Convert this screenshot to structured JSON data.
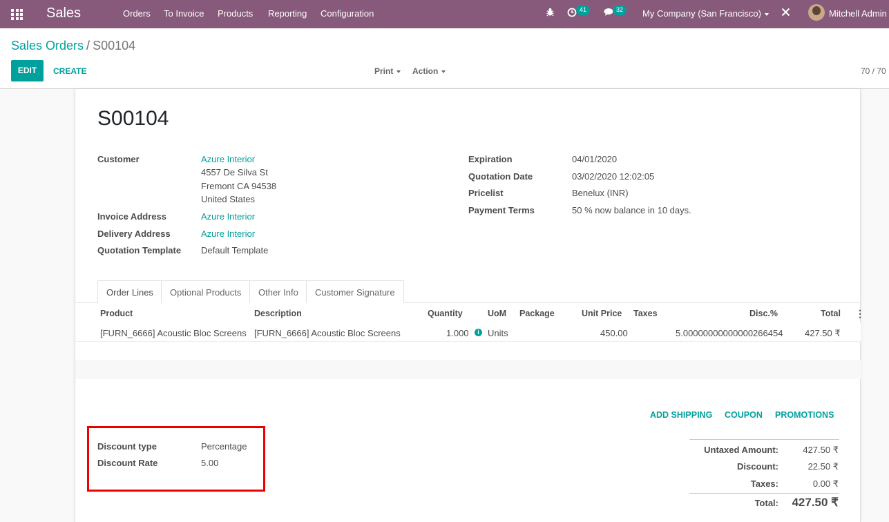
{
  "navbar": {
    "app_name": "Sales",
    "menu": [
      "Orders",
      "To Invoice",
      "Products",
      "Reporting",
      "Configuration"
    ],
    "activity_count": "41",
    "message_count": "32",
    "company": "My Company (San Francisco)",
    "user": "Mitchell Admin",
    "color": "#875a7b"
  },
  "breadcrumb": {
    "parent": "Sales Orders",
    "separator": "/",
    "current": "S00104"
  },
  "toolbar": {
    "edit": "EDIT",
    "create": "CREATE",
    "print": "Print",
    "action": "Action",
    "pager": "70 / 70"
  },
  "order": {
    "name": "S00104",
    "left": {
      "customer_label": "Customer",
      "customer": "Azure Interior",
      "address": [
        "4557 De Silva St",
        "Fremont CA 94538",
        "United States"
      ],
      "invoice_label": "Invoice Address",
      "invoice": "Azure Interior",
      "delivery_label": "Delivery Address",
      "delivery": "Azure Interior",
      "template_label": "Quotation Template",
      "template": "Default Template"
    },
    "right": {
      "expiration_label": "Expiration",
      "expiration": "04/01/2020",
      "qdate_label": "Quotation Date",
      "qdate": "03/02/2020 12:02:05",
      "pricelist_label": "Pricelist",
      "pricelist": "Benelux (INR)",
      "terms_label": "Payment Terms",
      "terms": "50 % now balance in 10 days."
    }
  },
  "tabs": [
    "Order Lines",
    "Optional Products",
    "Other Info",
    "Customer Signature"
  ],
  "lines": {
    "headers": [
      "Product",
      "Description",
      "Quantity",
      "UoM",
      "Package",
      "Unit Price",
      "Taxes",
      "Disc.%",
      "Total"
    ],
    "rows": [
      {
        "product": "[FURN_6666] Acoustic Bloc Screens",
        "description": "[FURN_6666] Acoustic Bloc Screens",
        "quantity": "1.000",
        "uom": "Units",
        "package": "",
        "unit_price": "450.00",
        "taxes": "",
        "discount": "5.00000000000000266454",
        "total": "427.50 ₹"
      }
    ]
  },
  "actions": [
    "ADD SHIPPING",
    "COUPON",
    "PROMOTIONS"
  ],
  "discount": {
    "type_label": "Discount type",
    "type": "Percentage",
    "rate_label": "Discount Rate",
    "rate": "5.00"
  },
  "totals": {
    "untaxed_label": "Untaxed Amount:",
    "untaxed": "427.50 ₹",
    "discount_label": "Discount:",
    "discount": "22.50 ₹",
    "taxes_label": "Taxes:",
    "taxes": "0.00 ₹",
    "total_label": "Total:",
    "total": "427.50 ₹"
  },
  "colors": {
    "accent": "#00a09d",
    "highlight_box": "#ee0000"
  }
}
